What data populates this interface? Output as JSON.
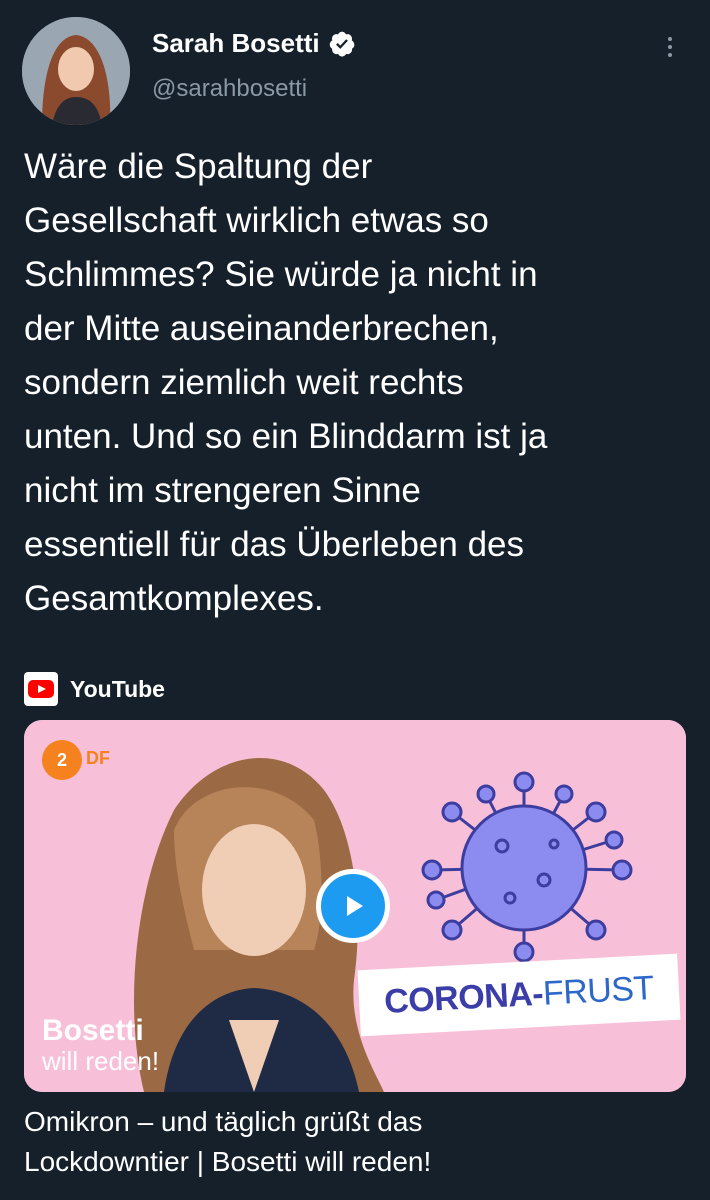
{
  "author": {
    "display_name": "Sarah Bosetti",
    "handle": "@sarahbosetti",
    "verified": true,
    "verified_icon": "verified-badge-icon"
  },
  "tweet": {
    "lines": [
      "Wäre die Spaltung der",
      "Gesellschaft wirklich etwas so",
      "Schlimmes? Sie würde ja nicht in",
      "der Mitte auseinanderbrechen,",
      "sondern ziemlich weit rechts",
      "unten. Und so ein Blinddarm ist ja",
      "nicht im strengeren Sinne",
      "essentiell für das Überleben des",
      "Gesamtkomplexes."
    ]
  },
  "link_card": {
    "source": "YouTube",
    "thumbnail": {
      "channel_logo_text": "2",
      "channel_logo_suffix": "DF",
      "banner_part1": "CORONA-",
      "banner_part2": "FRUST",
      "show_title": "Bosetti",
      "show_subtitle": "will reden!"
    },
    "title_lines": [
      "Omikron – und täglich grüßt das",
      "Lockdowntier | Bosetti will reden!"
    ]
  },
  "colors": {
    "background": "#15202b",
    "text": "#ffffff",
    "secondary_text": "#8b98a5",
    "accent": "#1d9bf0",
    "thumbnail_bg": "#f7bfd8",
    "virus": "#8c8cf0"
  }
}
